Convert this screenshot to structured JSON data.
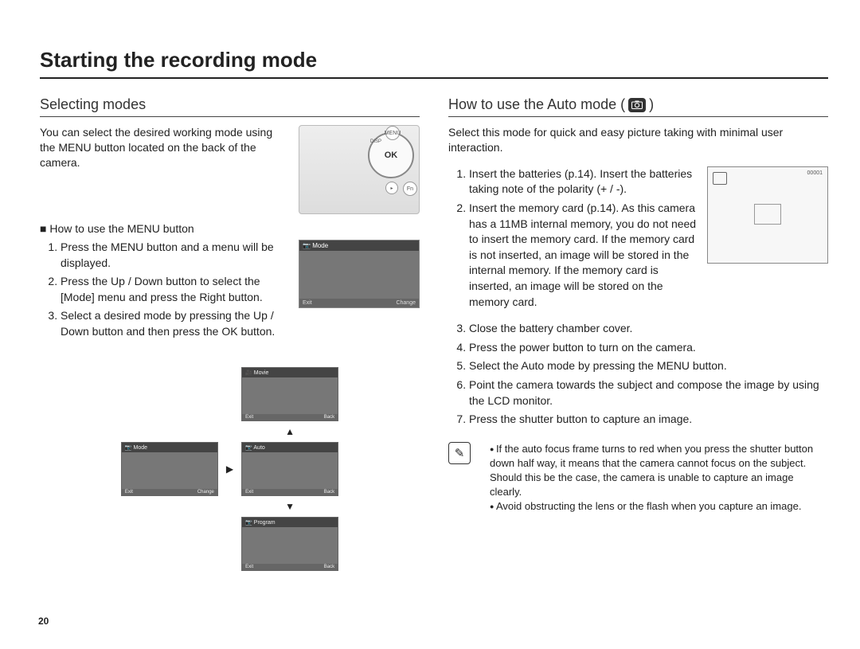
{
  "pageTitle": "Starting the recording mode",
  "pageNumber": "20",
  "left": {
    "sectionTitle": "Selecting modes",
    "intro": "You can select the desired working mode using the MENU button located on the back of the camera.",
    "menuButtonHeading": "How to use the MENU button",
    "steps": [
      "Press the MENU button and a menu will be displayed.",
      "Press the Up / Down button to select the [Mode] menu and press the Right button.",
      "Select a desired mode by pressing the Up / Down button and then press the OK button."
    ],
    "camera": {
      "okLabel": "OK",
      "dispLabel": "DISP",
      "fnLabel": "Fn",
      "menuLabel": "MENU"
    },
    "menuScreens": {
      "modeLabel": "Mode",
      "exitLabel": "Exit",
      "changeLabel": "Change",
      "backLabel": "Back",
      "movieLabel": "Movie",
      "autoLabel": "Auto",
      "programLabel": "Program"
    }
  },
  "right": {
    "sectionTitlePrefix": "How to use the Auto mode (",
    "sectionTitleSuffix": " )",
    "intro": "Select this mode for quick and easy picture taking with minimal user interaction.",
    "steps": [
      "Insert the batteries (p.14). Insert the batteries taking note of the polarity (+ / -).",
      "Insert the memory card (p.14). As this camera has a 11MB internal memory, you do not need to insert the memory card. If the memory card is not inserted, an image will be stored in the internal memory. If the memory card is inserted, an image will be stored on the memory card.",
      "Close the battery chamber cover.",
      "Press the power button to turn on the camera.",
      "Select the Auto mode by pressing the MENU button.",
      "Point the camera towards the subject and compose the image by using the LCD monitor.",
      "Press the shutter button to capture an image."
    ],
    "lcd": {
      "counter": "00001"
    },
    "notes": [
      "If the auto focus frame turns to red when you press the shutter button down half way, it means that the camera cannot focus on the subject. Should this be the case, the camera is unable to capture an image clearly.",
      "Avoid obstructing the lens or the flash when you capture an image."
    ]
  }
}
